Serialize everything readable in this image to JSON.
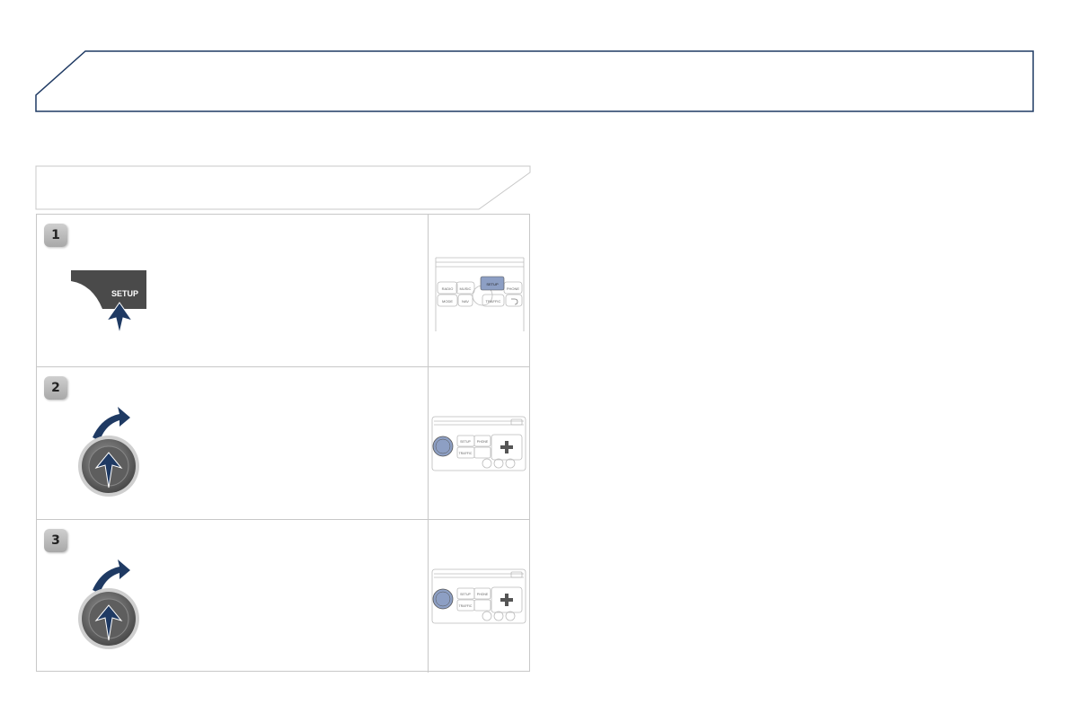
{
  "steps": [
    {
      "number": "1",
      "button_label": "SETUP"
    },
    {
      "number": "2"
    },
    {
      "number": "3"
    }
  ],
  "panel_labels": {
    "radio": "RADIO",
    "music": "MUSIC",
    "setup": "SETUP",
    "phone": "PHONE",
    "mode": "MODE",
    "nav": "NAV",
    "traffic": "TRAFFIC"
  },
  "icons": [
    "setup-button-icon",
    "press-arrow-icon",
    "rotary-knob-icon",
    "rotate-arrow-icon",
    "back-icon"
  ],
  "colors": {
    "accent": "#1f3a63",
    "panel_border": "#c8c8c8",
    "setup_button": "#4a4a4a",
    "knob": "#6a6a6a"
  }
}
